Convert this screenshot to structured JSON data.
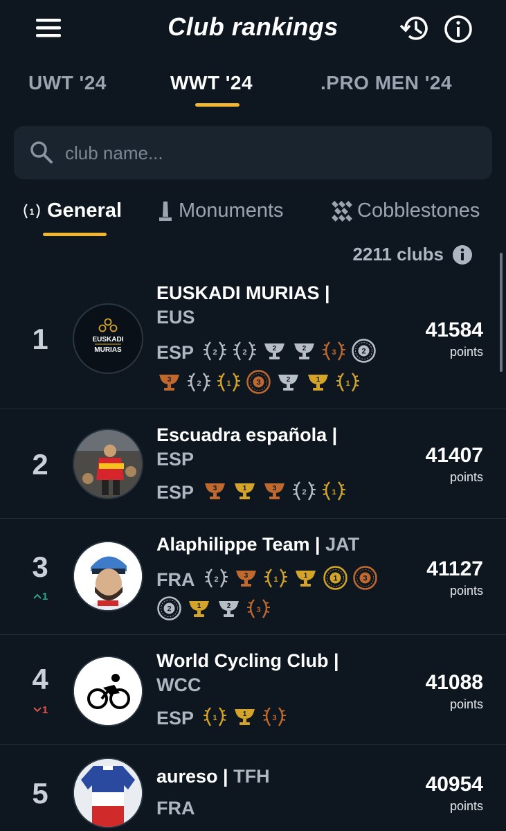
{
  "header": {
    "title": "Club rankings",
    "icons": [
      "menu-icon",
      "history-icon",
      "info-icon"
    ]
  },
  "tabs": [
    {
      "label": "UWT '24",
      "active": false
    },
    {
      "label": "WWT '24",
      "active": true
    },
    {
      "label": ".PRO MEN '24",
      "active": false
    }
  ],
  "search": {
    "placeholder": "club name..."
  },
  "subtabs": [
    {
      "label": "General",
      "icon": "laurel-icon",
      "active": true
    },
    {
      "label": "Monuments",
      "icon": "monument-icon",
      "active": false
    },
    {
      "label": "Cobblestones",
      "icon": "cobblestone-icon",
      "active": false
    }
  ],
  "count": "2211 clubs",
  "colors": {
    "bg": "#0e1720",
    "accent": "#f2b730",
    "gold": "#d4a42a",
    "silver": "#b8bec6",
    "bronze": "#c0692f",
    "up": "#2fa384",
    "down": "#d9534f"
  },
  "rows": [
    {
      "rank": "1",
      "name": "EUSKADI MURIAS |",
      "code": "EUS",
      "country": "ESP",
      "points": "41584",
      "points_label": "points",
      "logo_line1": "EUSKADI",
      "logo_line2": "MURIAS",
      "badges1": [
        [
          "laurel",
          "silver",
          "2"
        ],
        [
          "laurel",
          "silver",
          "2"
        ],
        [
          "cup",
          "silver",
          "2"
        ],
        [
          "cup",
          "silver",
          "2"
        ],
        [
          "laurel",
          "bronze",
          "3"
        ],
        [
          "wheel",
          "silver",
          "2"
        ]
      ],
      "badges2": [
        [
          "cup",
          "bronze",
          "3"
        ],
        [
          "laurel",
          "silver",
          "2"
        ],
        [
          "laurel",
          "gold",
          "1"
        ],
        [
          "wheel",
          "bronze",
          "3"
        ],
        [
          "cup",
          "silver",
          "2"
        ],
        [
          "cup",
          "gold",
          "1"
        ],
        [
          "laurel",
          "gold",
          "1"
        ]
      ]
    },
    {
      "rank": "2",
      "name": "Escuadra española  |",
      "code": "ESP",
      "country": "ESP",
      "points": "41407",
      "points_label": "points",
      "badges1": [
        [
          "cup",
          "bronze",
          "3"
        ],
        [
          "cup",
          "gold",
          "1"
        ],
        [
          "cup",
          "bronze",
          "3"
        ],
        [
          "laurel",
          "silver",
          "2"
        ],
        [
          "laurel",
          "gold",
          "1"
        ]
      ]
    },
    {
      "rank": "3",
      "move": "^1",
      "name": "Alaphilippe Team |",
      "code": "JAT",
      "country": "FRA",
      "points": "41127",
      "points_label": "points",
      "badges1": [
        [
          "laurel",
          "silver",
          "2"
        ],
        [
          "cup",
          "bronze",
          "3"
        ],
        [
          "laurel",
          "gold",
          "1"
        ],
        [
          "cup",
          "gold",
          "1"
        ],
        [
          "wheel",
          "gold",
          "1"
        ],
        [
          "wheel",
          "bronze",
          "3"
        ]
      ],
      "badges2": [
        [
          "wheel",
          "silver",
          "2"
        ],
        [
          "cup",
          "gold",
          "1"
        ],
        [
          "cup",
          "silver",
          "2"
        ],
        [
          "laurel",
          "bronze",
          "3"
        ]
      ]
    },
    {
      "rank": "4",
      "move": "v1",
      "name": "World Cycling Club |",
      "code": "WCC",
      "country": "ESP",
      "points": "41088",
      "points_label": "points",
      "badges1": [
        [
          "laurel",
          "gold",
          "1"
        ],
        [
          "cup",
          "gold",
          "1"
        ],
        [
          "laurel",
          "bronze",
          "3"
        ]
      ]
    },
    {
      "rank": "5",
      "name": "aureso |",
      "code": "TFH",
      "country": "FRA",
      "points": "40954",
      "points_label": "points"
    }
  ]
}
